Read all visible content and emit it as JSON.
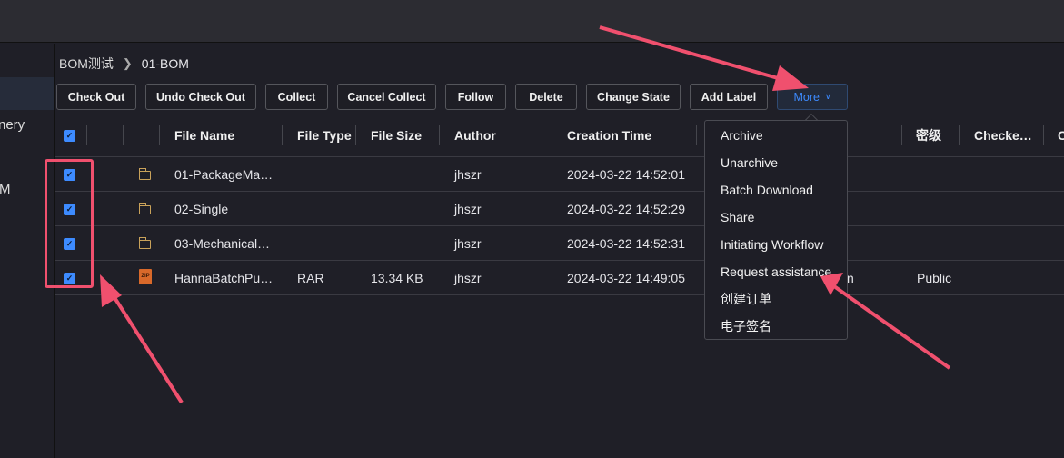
{
  "sidebar": {
    "items": [
      {
        "label": ""
      },
      {
        "label": "nery"
      },
      {
        "label": "M"
      }
    ]
  },
  "breadcrumb": {
    "parent": "BOM测试",
    "current": "01-BOM"
  },
  "toolbar": {
    "buttons": [
      "Check Out",
      "Undo Check Out",
      "Collect",
      "Cancel Collect",
      "Follow",
      "Delete",
      "Change State",
      "Add Label"
    ],
    "more_label": "More"
  },
  "table": {
    "columns": [
      "File Name",
      "File Type",
      "File Size",
      "Author",
      "Creation Time",
      "",
      "密级",
      "Checke…",
      "C"
    ],
    "rows": [
      {
        "checked": true,
        "icon": "folder-icon",
        "name": "01-PackageMa…",
        "type": "",
        "size": "",
        "author": "jhszr",
        "created": "2024-03-22 14:52:01",
        "hidden": "",
        "level": ""
      },
      {
        "checked": true,
        "icon": "folder-icon",
        "name": "02-Single",
        "type": "",
        "size": "",
        "author": "jhszr",
        "created": "2024-03-22 14:52:29",
        "hidden": "",
        "level": ""
      },
      {
        "checked": true,
        "icon": "folder-icon",
        "name": "03-Mechanical…",
        "type": "",
        "size": "",
        "author": "jhszr",
        "created": "2024-03-22 14:52:31",
        "hidden": "",
        "level": ""
      },
      {
        "checked": true,
        "icon": "zip-file-icon",
        "name": "HannaBatchPu…",
        "type": "RAR",
        "size": "13.34 KB",
        "author": "jhszr",
        "created": "2024-03-22 14:49:05",
        "hidden": "n",
        "level": "Public"
      }
    ]
  },
  "more_menu": {
    "items": [
      "Archive",
      "Unarchive",
      "Batch Download",
      "Share",
      "Initiating Workflow",
      "Request assistance",
      "创建订单",
      "电子签名"
    ]
  },
  "zip_icon_text": "ZIP",
  "colors": {
    "accent": "#3d8bff",
    "annotation": "#f0506e",
    "background": "#1f1f27"
  }
}
